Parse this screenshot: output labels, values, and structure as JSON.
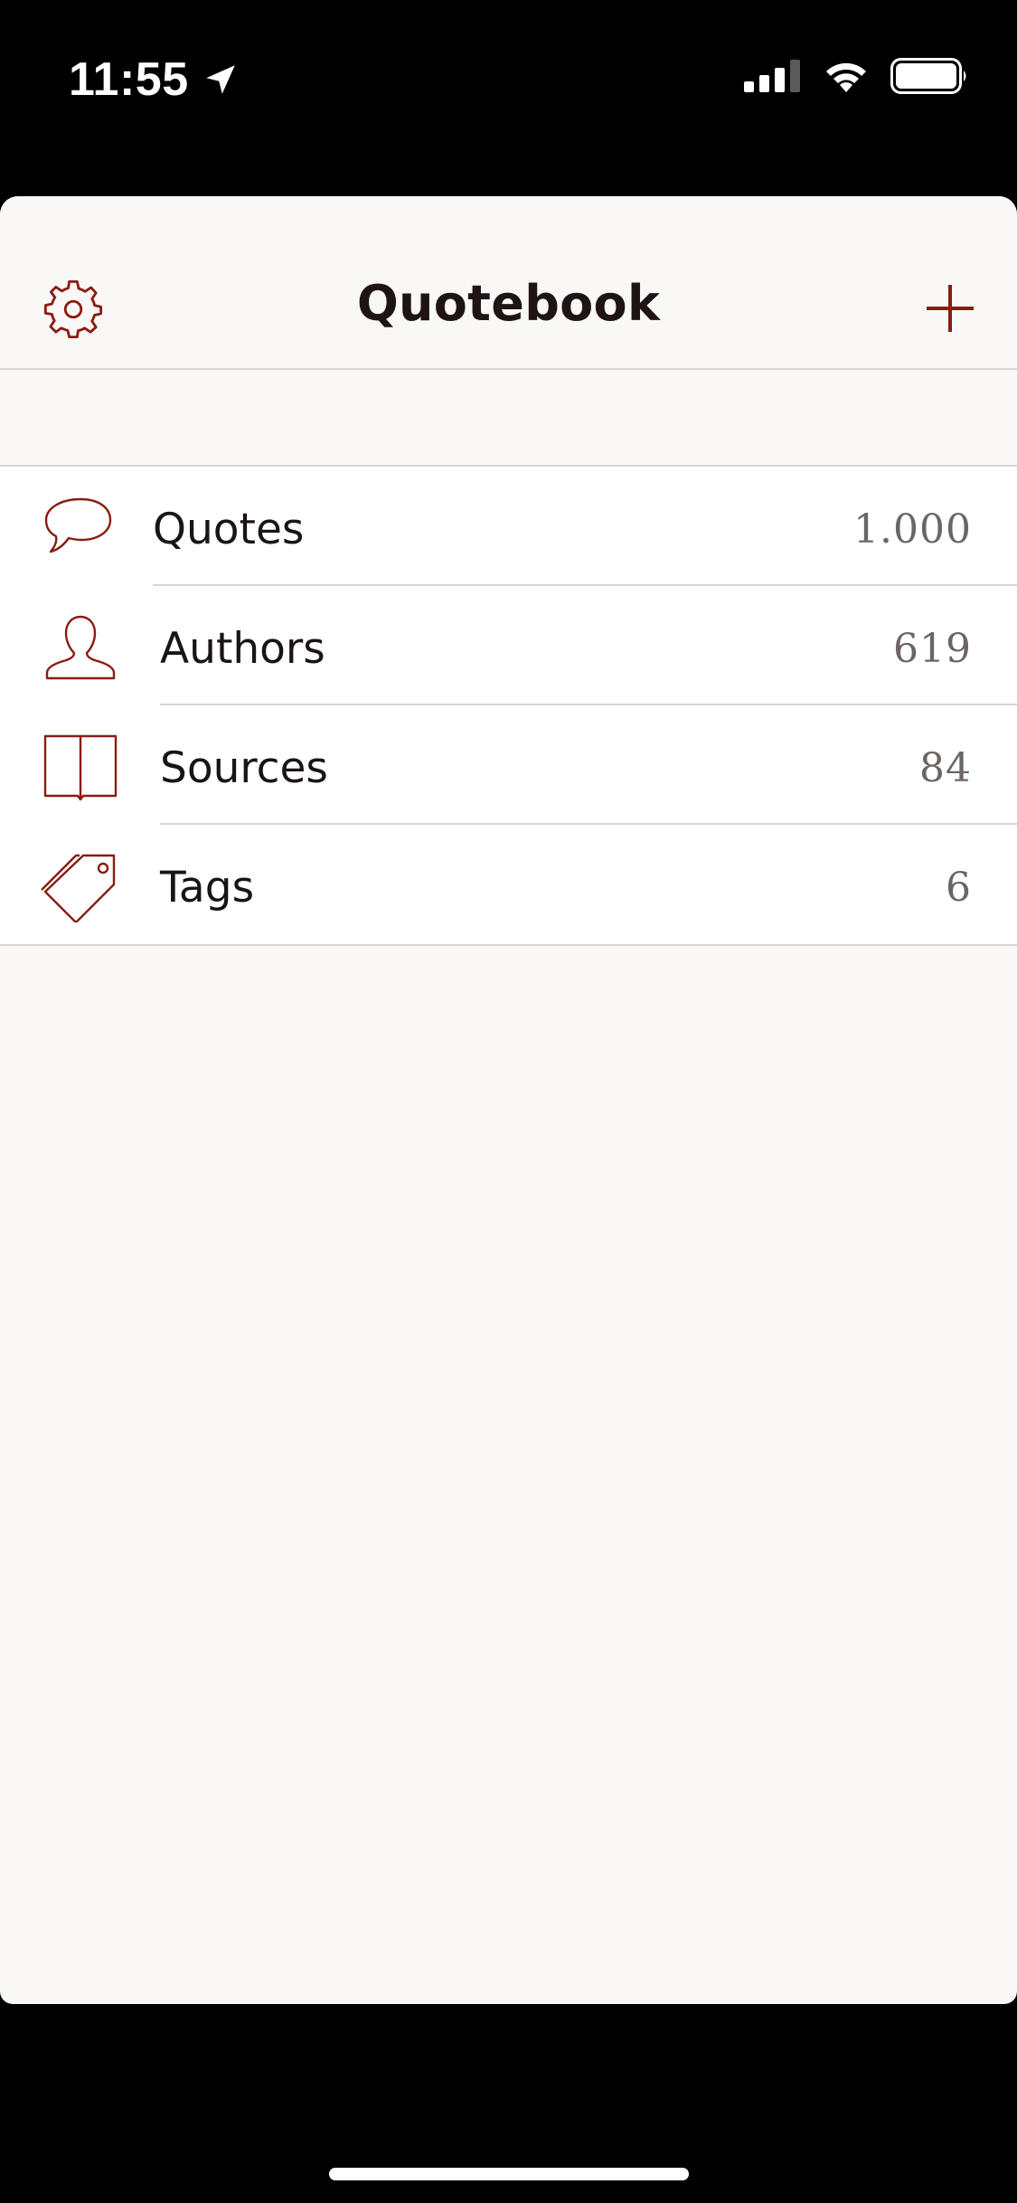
{
  "status_bar": {
    "time": "11:55",
    "icons": [
      "location-arrow-icon",
      "cellular-signal-icon",
      "wifi-icon",
      "battery-icon"
    ]
  },
  "nav": {
    "title": "Quotebook",
    "settings_icon": "gear-icon",
    "add_icon": "plus-icon"
  },
  "list": {
    "items": [
      {
        "label": "Quotes",
        "count": "1.000",
        "icon": "speech-bubble-icon"
      },
      {
        "label": "Authors",
        "count": "619",
        "icon": "person-icon"
      },
      {
        "label": "Sources",
        "count": "84",
        "icon": "book-icon"
      },
      {
        "label": "Tags",
        "count": "6",
        "icon": "tag-icon"
      }
    ]
  },
  "colors": {
    "accent": "#8a1c12",
    "background": "#f9f8f7",
    "row_background": "#ffffff",
    "text": "#1a1414",
    "secondary_text": "#6b6563"
  }
}
